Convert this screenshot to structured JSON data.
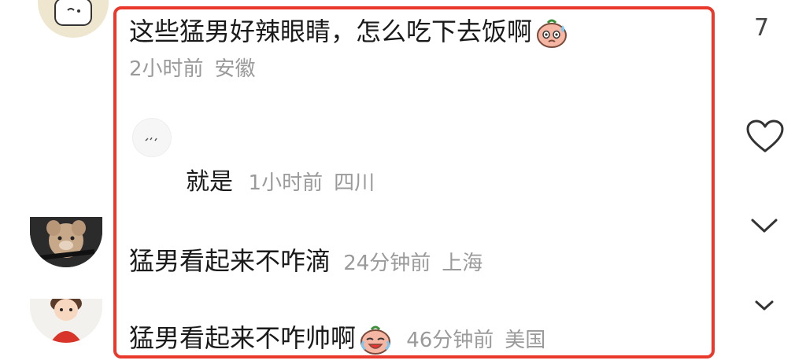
{
  "comments": [
    {
      "text": "这些猛男好辣眼睛，怎么吃下去饭啊",
      "emoji": "sweating-face-emoji",
      "time": "2小时前",
      "location": "安徽",
      "like_count": "7"
    }
  ],
  "reply": {
    "text": "就是",
    "time": "1小时前",
    "location": "四川"
  },
  "comment2": {
    "text": "猛男看起来不咋滴",
    "time": "24分钟前",
    "location": "上海"
  },
  "comment3": {
    "text": "猛男看起来不咋帅啊",
    "emoji": "crying-laughing-emoji",
    "time": "46分钟前",
    "location": "美国"
  },
  "icons": {
    "like": "heart-outline-icon",
    "expand": "chevron-down-icon"
  },
  "colors": {
    "highlight_border": "#e8392c",
    "meta_text": "#9a9a9a",
    "main_text": "#1a1a1a"
  }
}
